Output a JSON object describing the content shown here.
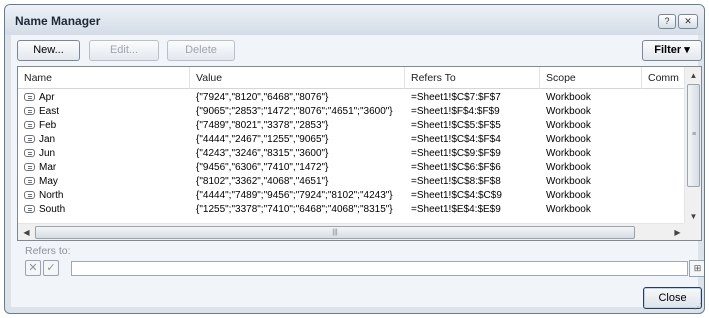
{
  "window": {
    "title": "Name Manager",
    "help_label": "?",
    "close_label": "✕"
  },
  "toolbar": {
    "new_label": "New...",
    "edit_label": "Edit...",
    "delete_label": "Delete",
    "filter_label": "Filter ▾"
  },
  "table": {
    "columns": [
      "Name",
      "Value",
      "Refers To",
      "Scope",
      "Comm"
    ],
    "rows": [
      {
        "name": "Apr",
        "value": "{\"7924\",\"8120\",\"6468\",\"8076\"}",
        "refers_to": "=Sheet1!$C$7:$F$7",
        "scope": "Workbook"
      },
      {
        "name": "East",
        "value": "{\"9065\";\"2853\";\"1472\";\"8076\";\"4651\";\"3600\"}",
        "refers_to": "=Sheet1!$F$4:$F$9",
        "scope": "Workbook"
      },
      {
        "name": "Feb",
        "value": "{\"7489\",\"8021\",\"3378\",\"2853\"}",
        "refers_to": "=Sheet1!$C$5:$F$5",
        "scope": "Workbook"
      },
      {
        "name": "Jan",
        "value": "{\"4444\",\"2467\",\"1255\",\"9065\"}",
        "refers_to": "=Sheet1!$C$4:$F$4",
        "scope": "Workbook"
      },
      {
        "name": "Jun",
        "value": "{\"4243\",\"3246\",\"8315\",\"3600\"}",
        "refers_to": "=Sheet1!$C$9:$F$9",
        "scope": "Workbook"
      },
      {
        "name": "Mar",
        "value": "{\"9456\",\"6306\",\"7410\",\"1472\"}",
        "refers_to": "=Sheet1!$C$6:$F$6",
        "scope": "Workbook"
      },
      {
        "name": "May",
        "value": "{\"8102\",\"3362\",\"4068\",\"4651\"}",
        "refers_to": "=Sheet1!$C$8:$F$8",
        "scope": "Workbook"
      },
      {
        "name": "North",
        "value": "{\"4444\";\"7489\";\"9456\";\"7924\";\"8102\";\"4243\"}",
        "refers_to": "=Sheet1!$C$4:$C$9",
        "scope": "Workbook"
      },
      {
        "name": "South",
        "value": "{\"1255\";\"3378\";\"7410\";\"6468\";\"4068\";\"8315\"}",
        "refers_to": "=Sheet1!$E$4:$E$9",
        "scope": "Workbook"
      }
    ]
  },
  "refers_to": {
    "label": "Refers to:",
    "cancel_label": "✕",
    "confirm_label": "✓",
    "value": ""
  },
  "footer": {
    "close_label": "Close"
  }
}
